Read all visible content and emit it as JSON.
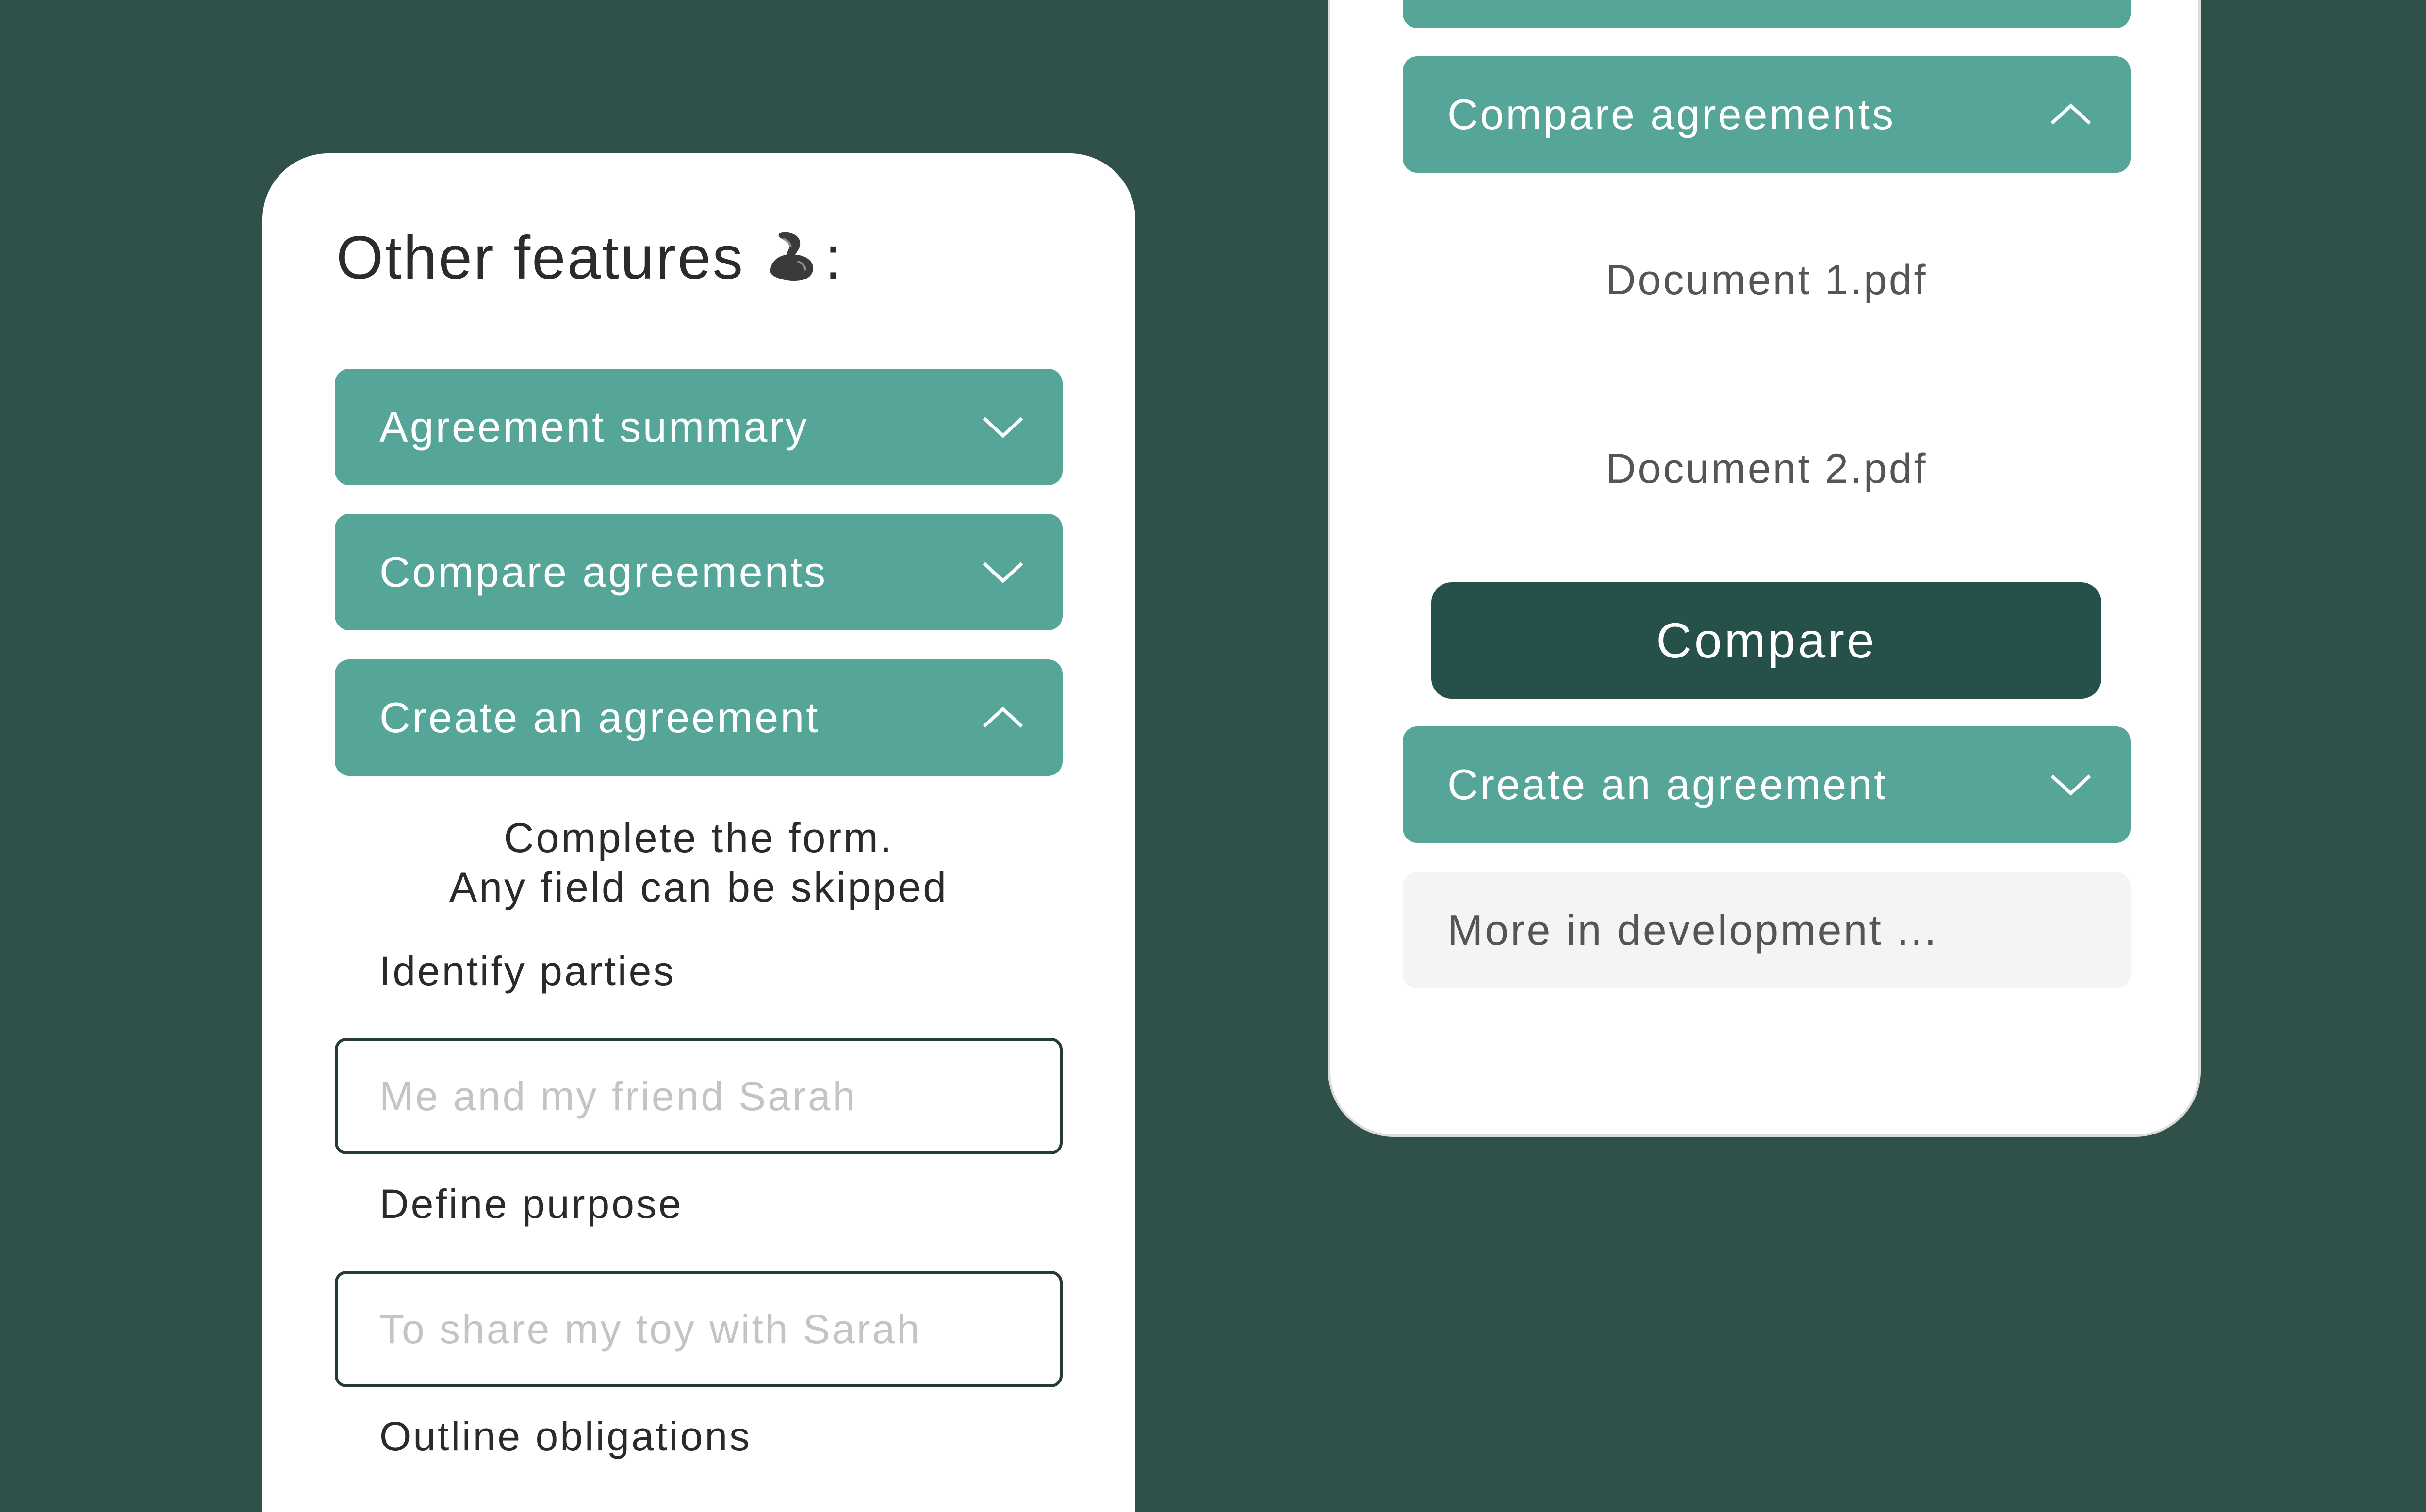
{
  "left_panel": {
    "title": "Other features",
    "title_suffix": ":",
    "title_icon": "flexed-biceps-icon",
    "accordions": [
      {
        "label": "Agreement summary",
        "state": "collapsed",
        "icon": "chevron-down-icon"
      },
      {
        "label": "Compare agreements",
        "state": "collapsed",
        "icon": "chevron-down-icon"
      },
      {
        "label": "Create an agreement",
        "state": "expanded",
        "icon": "chevron-up-icon"
      }
    ],
    "form": {
      "intro_line1": "Complete the form.",
      "intro_line2": "Any field can be skipped",
      "fields": [
        {
          "label": "Identify parties",
          "placeholder": "Me and my friend Sarah"
        },
        {
          "label": "Define purpose",
          "placeholder": "To share my toy with Sarah"
        },
        {
          "label": "Outline obligations"
        }
      ]
    }
  },
  "right_panel": {
    "compare_accordion": {
      "label": "Compare agreements",
      "state": "expanded",
      "icon": "chevron-up-icon"
    },
    "documents": [
      "Document 1.pdf",
      "Document 2.pdf"
    ],
    "compare_button": "Compare",
    "create_accordion": {
      "label": "Create an agreement",
      "state": "collapsed",
      "icon": "chevron-down-icon"
    },
    "more_text": "More in development ..."
  },
  "colors": {
    "background": "#30504a",
    "accordion": "#55a699",
    "button_dark": "#26504a",
    "card": "#ffffff",
    "muted_panel": "#f4f4f4"
  }
}
